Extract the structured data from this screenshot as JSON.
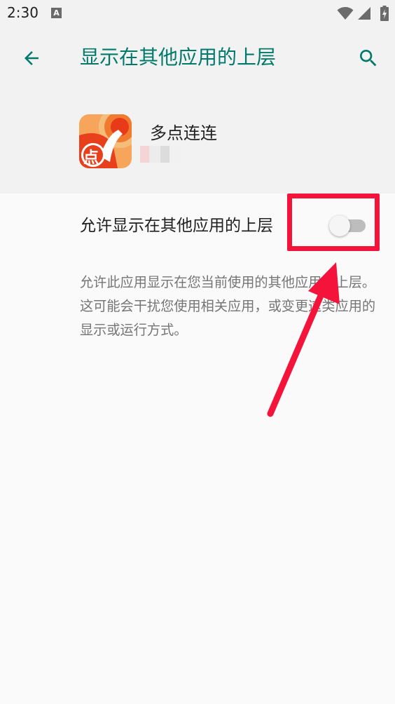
{
  "status_bar": {
    "time": "2:30",
    "notification_icon": "A",
    "icons": [
      "wifi-icon",
      "signal-icon",
      "battery-charging-icon"
    ]
  },
  "app_bar": {
    "title": "显示在其他应用的上层",
    "back_icon": "arrow-back-icon",
    "search_icon": "search-icon",
    "accent_color": "#00796b"
  },
  "app_info": {
    "name": "多点连连",
    "icon_text": "点",
    "icon_color": "#e8401c"
  },
  "permission": {
    "label": "允许显示在其他应用的上层",
    "enabled": false,
    "description": "允许此应用显示在您当前使用的其他应用的上层。这可能会干扰您使用相关应用，或变更这类应用的显示或运行方式。"
  },
  "annotation": {
    "color": "#f4133a",
    "type": "highlight-box-with-arrow"
  }
}
